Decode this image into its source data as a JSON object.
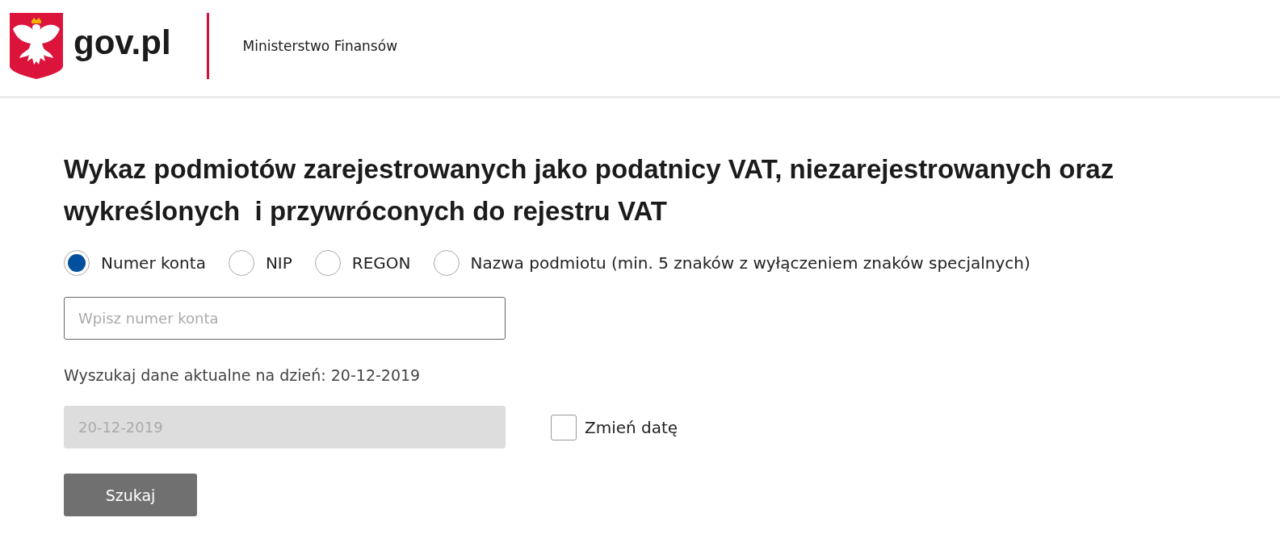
{
  "header": {
    "logo_text": "gov.pl",
    "ministry": "Ministerstwo Finansów"
  },
  "title": "Wykaz podmiotów zarejestrowanych jako podatnicy VAT, niezarejestrowanych oraz wykreślonych  i przywróconych do rejestru VAT",
  "search_options": [
    {
      "label": "Numer konta",
      "selected": true
    },
    {
      "label": "NIP",
      "selected": false
    },
    {
      "label": "REGON",
      "selected": false
    },
    {
      "label": "Nazwa podmiotu (min. 5 znaków z wyłączeniem znaków specjalnych)",
      "selected": false
    }
  ],
  "search_field": {
    "placeholder": "Wpisz numer konta"
  },
  "date_label": "Wyszukaj dane aktualne na dzień: 20-12-2019",
  "date_field": {
    "value": "20-12-2019",
    "disabled": true
  },
  "change_date": {
    "label": "Zmień datę",
    "checked": false
  },
  "search_button": "Szukaj"
}
